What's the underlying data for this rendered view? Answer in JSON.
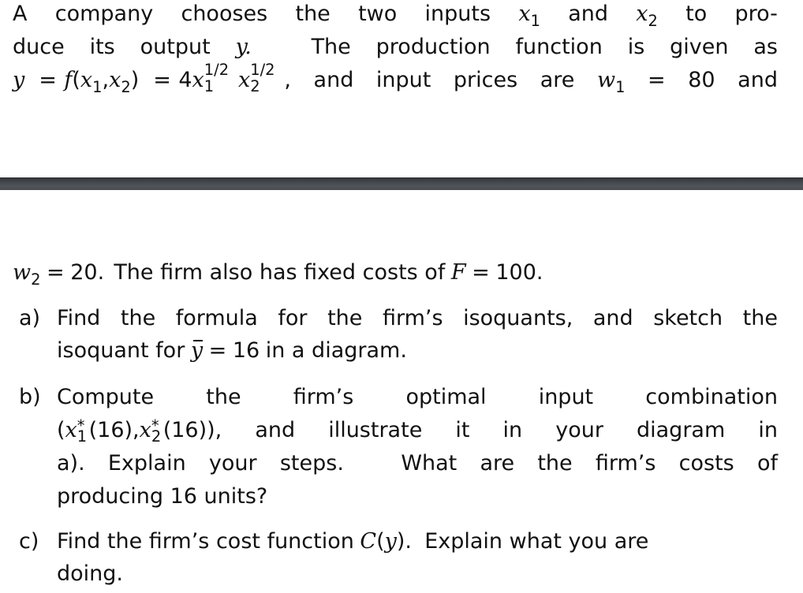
{
  "document": {
    "page_top": {
      "line1": {
        "words": [
          "A",
          "company",
          "chooses",
          "the",
          "two",
          "inputs"
        ],
        "var_x1": "x",
        "x1_sub": "1",
        "and": "and",
        "var_x2": "x",
        "x2_sub": "2",
        "to": "to",
        "pro": "pro-"
      },
      "line2": {
        "words": [
          "duce",
          "its",
          "output"
        ],
        "var_y": "y.",
        "words_after": [
          "The",
          "production",
          "function",
          "is",
          "given",
          "as"
        ]
      },
      "line3": {
        "lhs_y": "y",
        "eq1": "=",
        "f_expr_f": "f",
        "f_open": "(",
        "f_x1": "x",
        "f_x1_sub": "1",
        "comma": ",",
        "f_x2": "x",
        "f_x2_sub": "2",
        "f_close": ")",
        "eq2": "=",
        "coef": "4",
        "x1": "x",
        "x1_exp": "1/2",
        "x1_sub": "1",
        "x2": "x",
        "x2_exp": "1/2",
        "x2_sub": "2",
        "trail": ",",
        "words": [
          "and",
          "input",
          "prices",
          "are"
        ],
        "w1": "w",
        "w1_sub": "1",
        "eq3": "=",
        "w1_value": "80",
        "and_end": "and"
      }
    },
    "page_break": {
      "color_top": "#2f3336",
      "color_bottom": "#4f5458"
    },
    "page_bottom": {
      "intro": {
        "w2": "w",
        "w2_sub": "2",
        "eq": "=",
        "w2_value": "20.",
        "text": "The firm also has fixed costs of",
        "F": "F",
        "eq2": "=",
        "F_value": "100."
      },
      "items": [
        {
          "label": "a)",
          "line1_words": [
            "Find",
            "the",
            "formula",
            "for",
            "the",
            "firm’s",
            "isoquants,",
            "and",
            "sketch",
            "the"
          ],
          "line2_pre": "isoquant for",
          "ybar": "y",
          "eq": "=",
          "ybar_value": "16",
          "line2_post": "in a diagram."
        },
        {
          "label": "b)",
          "line1_words": [
            "Compute",
            "the",
            "firm’s",
            "optimal",
            "input",
            "combination"
          ],
          "line2_expr": {
            "open": "(",
            "x1": "x",
            "x1_star": "*",
            "x1_sub": "1",
            "x1_arg": "(16),",
            "x2": "x",
            "x2_star": "*",
            "x2_sub": "2",
            "x2_arg": "(16)),"
          },
          "line2_words": [
            "and",
            "illustrate",
            "it",
            "in",
            "your",
            "diagram",
            "in"
          ],
          "line3_words": [
            "a).",
            "Explain",
            "your",
            "steps.",
            "What",
            "are",
            "the",
            "firm’s",
            "costs",
            "of"
          ],
          "line4": "producing 16 units?"
        },
        {
          "label": "c)",
          "line1_pre": "Find the firm’s cost function",
          "C": "C",
          "C_arg_open": "(",
          "C_arg": "y",
          "C_arg_close": ").",
          "line1_post": "Explain what you are",
          "line2": "doing."
        }
      ]
    }
  }
}
